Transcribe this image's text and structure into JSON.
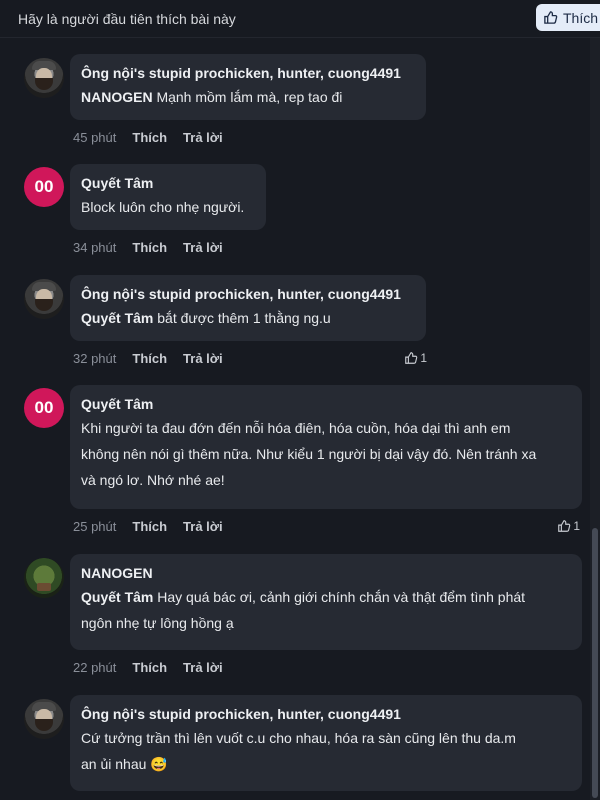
{
  "header": {
    "prompt": "Hãy là người đầu tiên thích bài này",
    "like_label": "Thích"
  },
  "comments": [
    {
      "avatar": "photo-man-beard",
      "author": "Ông nội's stupid prochicken, hunter, cuong4491",
      "mention": "NANOGEN",
      "text": " Mạnh mồm lắm mà, rep tao đi",
      "time": "45 phút",
      "like": "Thích",
      "reply": "Trả lời"
    },
    {
      "avatar_initials": "00",
      "author": "Quyết Tâm",
      "text": "Block luôn cho nhẹ người.",
      "time": "34 phút",
      "like": "Thích",
      "reply": "Trả lời"
    },
    {
      "avatar": "photo-man-beard",
      "author": "Ông nội's stupid prochicken, hunter, cuong4491",
      "mention": "Quyết Tâm",
      "text": " bắt được thêm 1 thằng ng.u",
      "time": "32 phút",
      "like": "Thích",
      "reply": "Trả lời",
      "reaction_count": "1"
    },
    {
      "avatar_initials": "00",
      "author": "Quyết Tâm",
      "lines": [
        "Khi người ta đau đớn đến nỗi hóa điên, hóa cuồn, hóa dại thì anh em",
        "không nên nói gì thêm nữa. Như kiểu 1 người bị dại vậy đó. Nên tránh xa",
        "và ngó lơ. Nhớ nhé ae!"
      ],
      "time": "25 phút",
      "like": "Thích",
      "reply": "Trả lời",
      "reaction_count": "1"
    },
    {
      "avatar": "photo-bonsai",
      "author": "NANOGEN",
      "mention": "Quyết Tâm",
      "line1": " Hay quá bác ơi, cảnh giới chính chắn và thật đểm tình phát",
      "line2": "ngôn nhẹ tự lông hồng ạ",
      "time": "22 phút",
      "like": "Thích",
      "reply": "Trả lời"
    },
    {
      "avatar": "photo-man-beard",
      "author": "Ông nội's stupid prochicken, hunter, cuong4491",
      "line1": "Cứ tưởng trần thì lên vuốt c.u cho nhau, hóa ra sàn cũng lên thu da.m",
      "line2": "an ủi nhau 😅"
    }
  ],
  "icons": {
    "like": "thumbs-up-icon"
  },
  "colors": {
    "background": "#171a21",
    "bubble": "#262a33",
    "avatar_pink": "#d0175a",
    "like_button_bg": "#e4ecf8"
  }
}
